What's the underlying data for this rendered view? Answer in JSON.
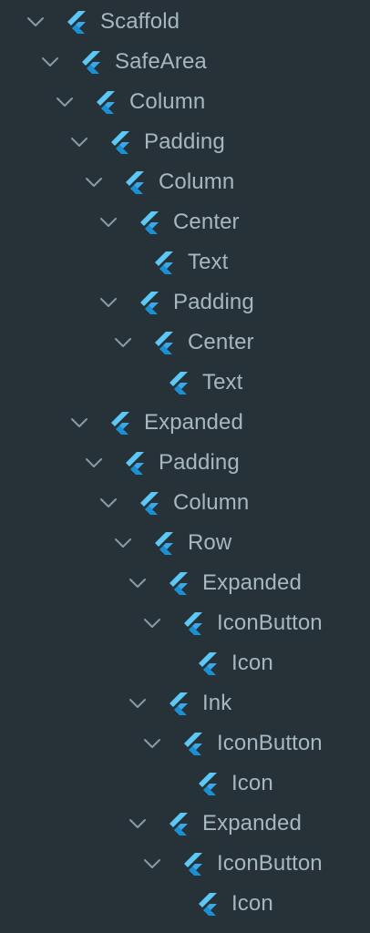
{
  "colors": {
    "background": "#263238",
    "label": "#a7b7c1",
    "chevron": "#8a9aa4",
    "logo_light": "#5cc8f6",
    "logo_dark": "#1a8fd4",
    "logo_mid": "#3aa8e8"
  },
  "tree": {
    "nodes": [
      {
        "label": "Scaffold",
        "depth": 0,
        "expanded": true,
        "icon": "flutter-icon"
      },
      {
        "label": "SafeArea",
        "depth": 1,
        "expanded": true,
        "icon": "flutter-icon"
      },
      {
        "label": "Column",
        "depth": 2,
        "expanded": true,
        "icon": "flutter-icon"
      },
      {
        "label": "Padding",
        "depth": 3,
        "expanded": true,
        "icon": "flutter-icon"
      },
      {
        "label": "Column",
        "depth": 4,
        "expanded": true,
        "icon": "flutter-icon"
      },
      {
        "label": "Center",
        "depth": 5,
        "expanded": true,
        "icon": "flutter-icon"
      },
      {
        "label": "Text",
        "depth": 6,
        "expanded": false,
        "icon": "flutter-icon"
      },
      {
        "label": "Padding",
        "depth": 5,
        "expanded": true,
        "icon": "flutter-icon"
      },
      {
        "label": "Center",
        "depth": 6,
        "expanded": true,
        "icon": "flutter-icon"
      },
      {
        "label": "Text",
        "depth": 7,
        "expanded": false,
        "icon": "flutter-icon"
      },
      {
        "label": "Expanded",
        "depth": 3,
        "expanded": true,
        "icon": "flutter-icon"
      },
      {
        "label": "Padding",
        "depth": 4,
        "expanded": true,
        "icon": "flutter-icon"
      },
      {
        "label": "Column",
        "depth": 5,
        "expanded": true,
        "icon": "flutter-icon"
      },
      {
        "label": "Row",
        "depth": 6,
        "expanded": true,
        "icon": "flutter-icon"
      },
      {
        "label": "Expanded",
        "depth": 7,
        "expanded": true,
        "icon": "flutter-icon"
      },
      {
        "label": "IconButton",
        "depth": 8,
        "expanded": true,
        "icon": "flutter-icon"
      },
      {
        "label": "Icon",
        "depth": 9,
        "expanded": false,
        "icon": "flutter-icon"
      },
      {
        "label": "Ink",
        "depth": 7,
        "expanded": true,
        "icon": "flutter-icon"
      },
      {
        "label": "IconButton",
        "depth": 8,
        "expanded": true,
        "icon": "flutter-icon"
      },
      {
        "label": "Icon",
        "depth": 9,
        "expanded": false,
        "icon": "flutter-icon"
      },
      {
        "label": "Expanded",
        "depth": 7,
        "expanded": true,
        "icon": "flutter-icon"
      },
      {
        "label": "IconButton",
        "depth": 8,
        "expanded": true,
        "icon": "flutter-icon"
      },
      {
        "label": "Icon",
        "depth": 9,
        "expanded": false,
        "icon": "flutter-icon"
      }
    ]
  }
}
